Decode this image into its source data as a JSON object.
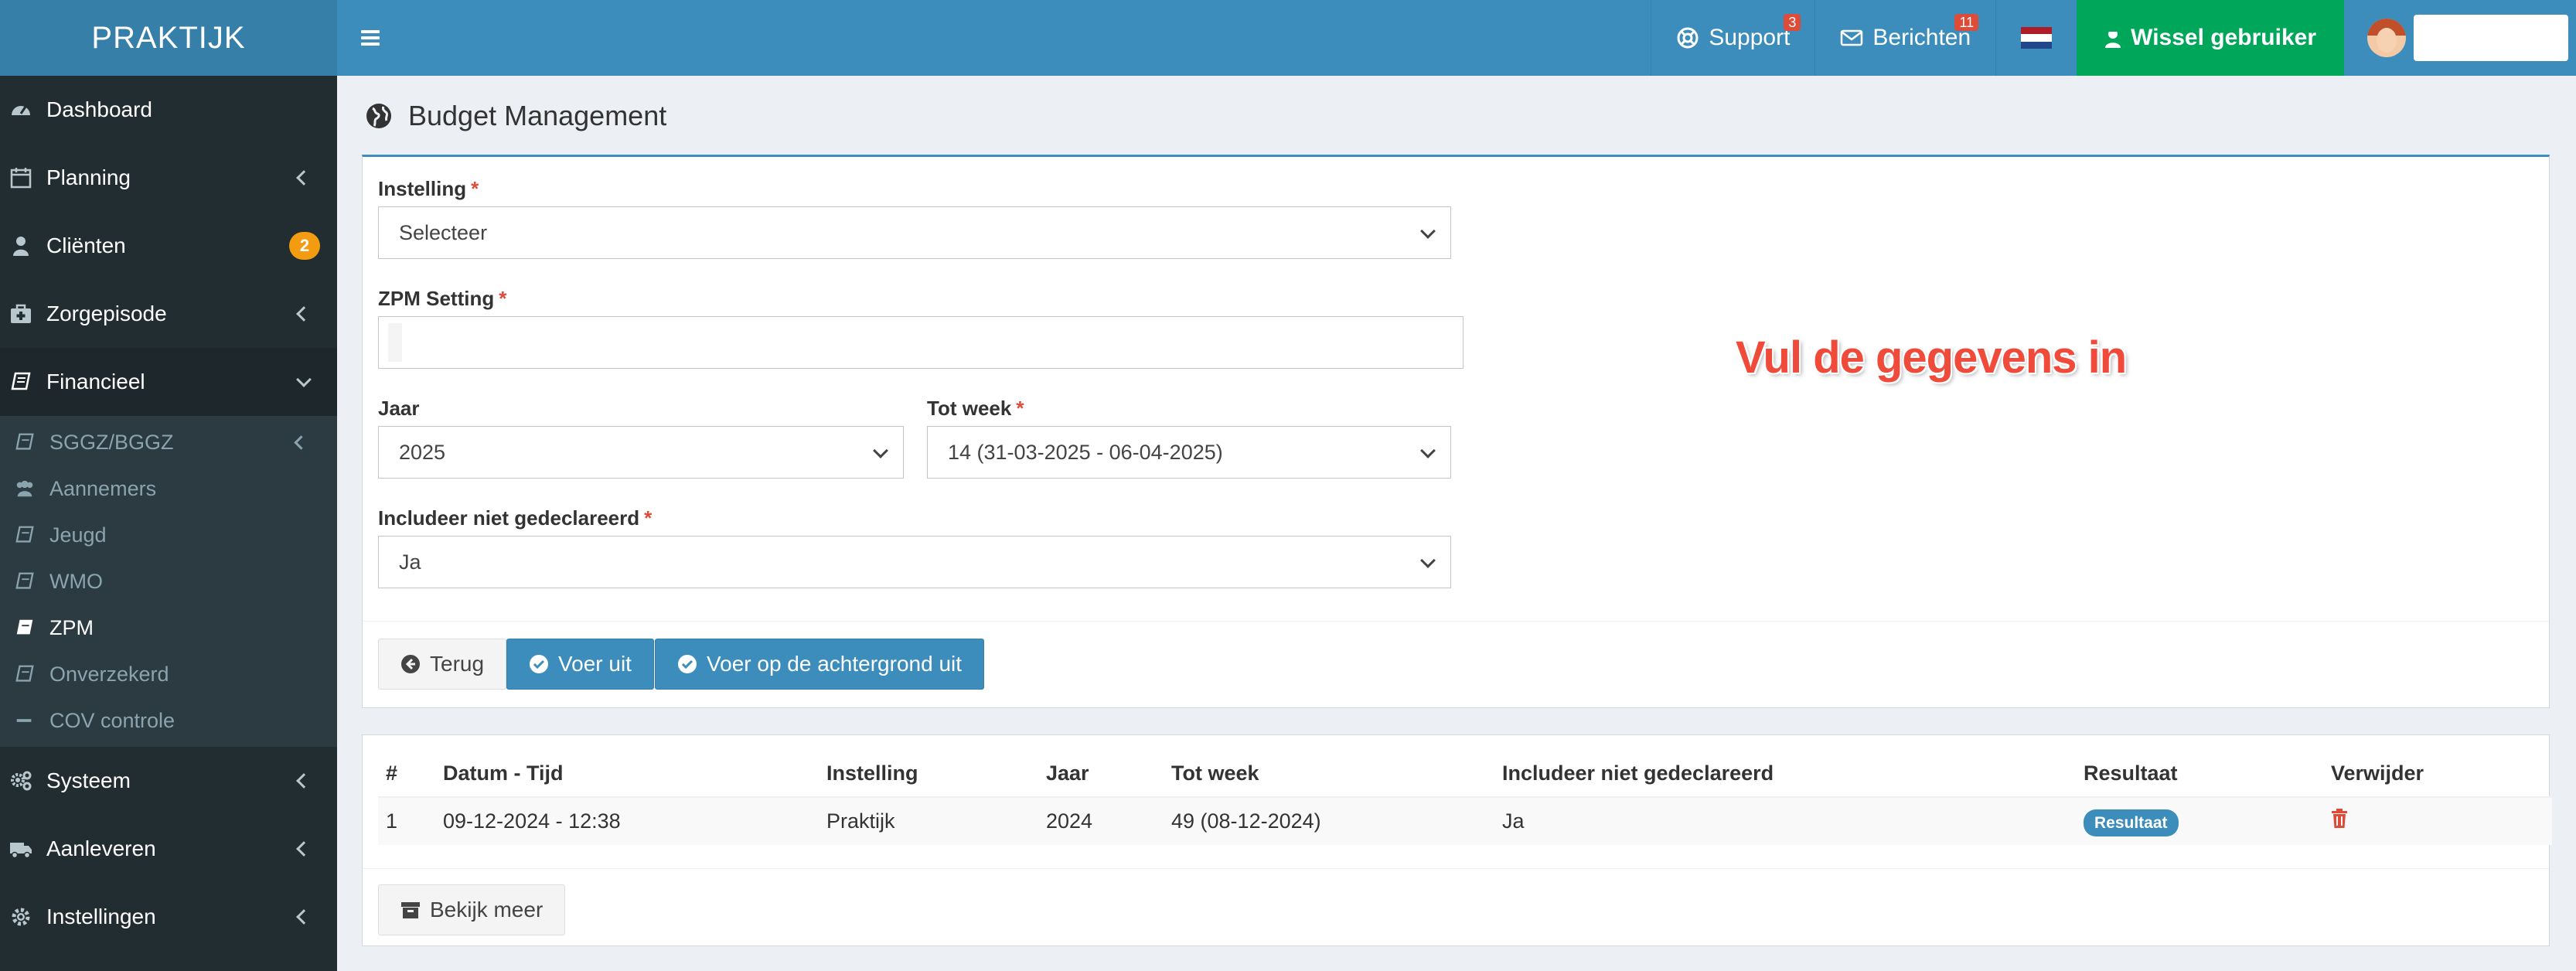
{
  "header": {
    "logo": "PRAKTIJK",
    "support_label": "Support",
    "support_count": "3",
    "messages_label": "Berichten",
    "messages_count": "11",
    "switch_user_label": "Wissel gebruiker"
  },
  "sidebar": {
    "items": [
      {
        "label": "Dashboard"
      },
      {
        "label": "Planning"
      },
      {
        "label": "Cliënten",
        "badge": "2"
      },
      {
        "label": "Zorgepisode"
      },
      {
        "label": "Financieel"
      },
      {
        "label": "Systeem"
      },
      {
        "label": "Aanleveren"
      },
      {
        "label": "Instellingen"
      }
    ],
    "submenu": [
      {
        "label": "SGGZ/BGGZ"
      },
      {
        "label": "Aannemers"
      },
      {
        "label": "Jeugd"
      },
      {
        "label": "WMO"
      },
      {
        "label": "ZPM"
      },
      {
        "label": "Onverzekerd"
      },
      {
        "label": "COV controle"
      }
    ]
  },
  "page": {
    "title": "Budget Management"
  },
  "form": {
    "instelling_label": "Instelling",
    "instelling_value": "Selecteer",
    "zpm_label": "ZPM Setting",
    "jaar_label": "Jaar",
    "jaar_value": "2025",
    "tot_week_label": "Tot week",
    "tot_week_value": "14 (31-03-2025 - 06-04-2025)",
    "includeer_label": "Includeer niet gedeclareerd",
    "includeer_value": "Ja",
    "required_mark": "*",
    "annotation": "Vul de gegevens in",
    "back_button": "Terug",
    "run_button": "Voer uit",
    "run_background_button": "Voer op de achtergrond uit"
  },
  "table": {
    "columns": [
      "#",
      "Datum - Tijd",
      "Instelling",
      "Jaar",
      "Tot week",
      "Includeer niet gedeclareerd",
      "Resultaat",
      "Verwijder"
    ],
    "rows": [
      {
        "num": "1",
        "datetime": "09-12-2024 - 12:38",
        "instelling": "Praktijk",
        "jaar": "2024",
        "tot_week": "49 (08-12-2024)",
        "includeer": "Ja",
        "resultaat": "Resultaat"
      }
    ],
    "more_button": "Bekijk meer"
  },
  "colors": {
    "brand_blue": "#3c8dbc",
    "logo_blue": "#367fa9",
    "success_green": "#00a65a",
    "sidebar_dark": "#222d32",
    "danger_red": "#dd4b39",
    "warning_orange": "#f39c12"
  }
}
